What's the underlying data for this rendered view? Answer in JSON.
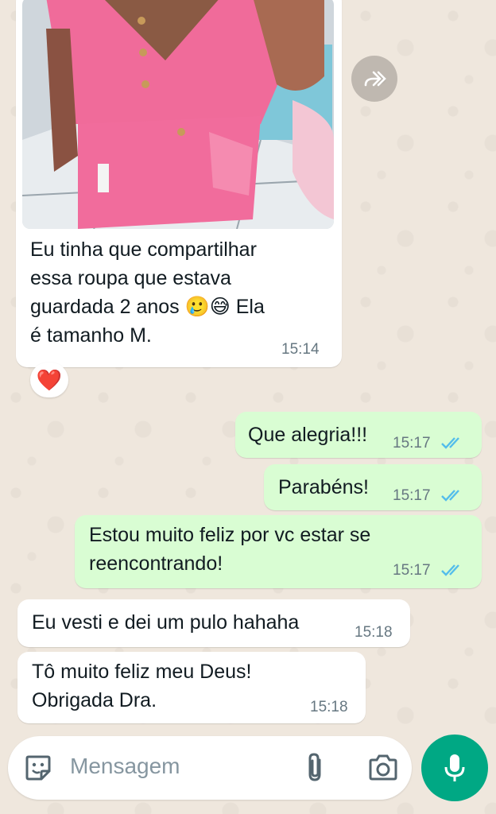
{
  "conversation": {
    "received_image": {
      "caption": "Eu tinha que compartilhar\nessa roupa que estava\nguardada 2 anos 🥲😅 Ela\né tamanho M.",
      "time": "15:14",
      "reaction": "❤️"
    },
    "messages": [
      {
        "direction": "out",
        "text": "Que alegria!!!",
        "time": "15:17",
        "status": "read"
      },
      {
        "direction": "out",
        "text": "Parabéns!",
        "time": "15:17",
        "status": "read"
      },
      {
        "direction": "out",
        "text": "Estou muito feliz por vc estar se\nreencontrando!",
        "time": "15:17",
        "status": "read"
      },
      {
        "direction": "in",
        "text": "Eu vesti e dei um pulo hahaha",
        "time": "15:18"
      },
      {
        "direction": "in",
        "text": "Tô muito feliz meu Deus!\nObrigada Dra.",
        "time": "15:18"
      }
    ]
  },
  "composer": {
    "placeholder": "Mensagem",
    "icons": [
      "sticker-icon",
      "attach-icon",
      "camera-icon",
      "mic-icon"
    ]
  },
  "colors": {
    "incoming_bubble": "#ffffff",
    "outgoing_bubble": "#d9fdd3",
    "read_ticks": "#53bdeb",
    "accent": "#00a884",
    "wallpaper": "#efe7dd"
  }
}
